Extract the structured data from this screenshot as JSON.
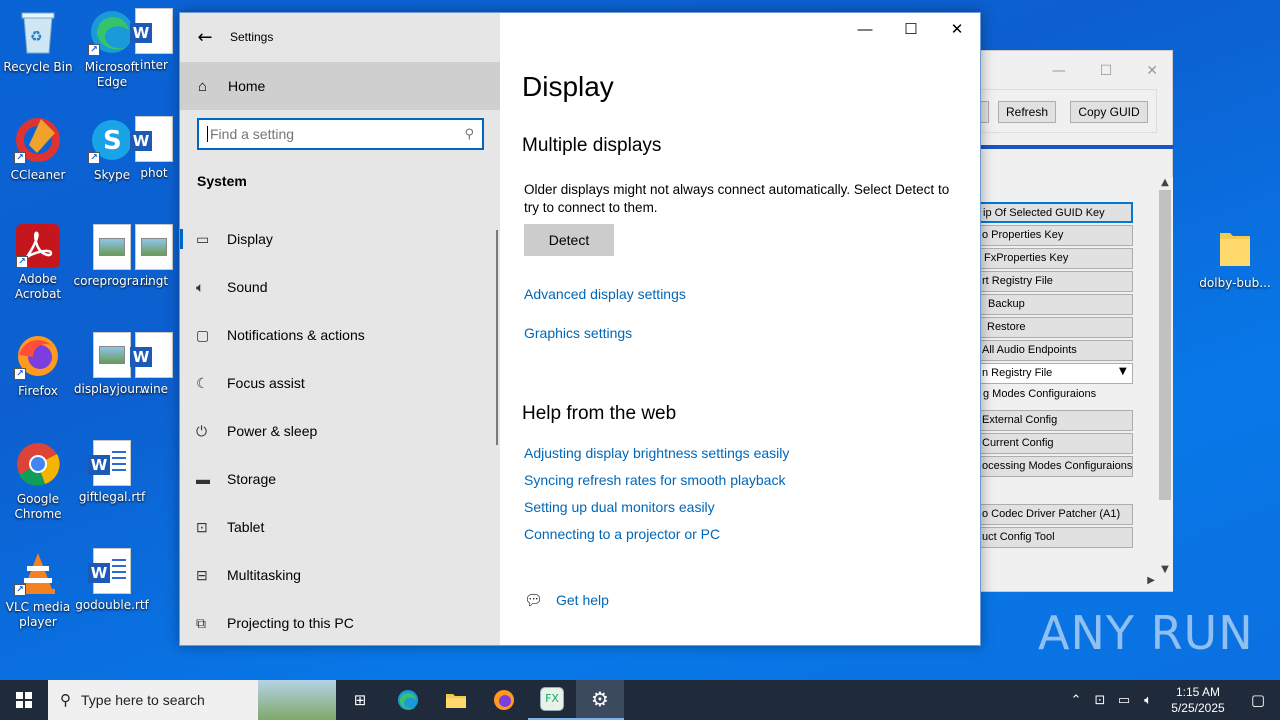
{
  "desktop": {
    "icons": [
      {
        "label": "Recycle Bin"
      },
      {
        "label": "Microsoft Edge"
      },
      {
        "label": "inter"
      },
      {
        "label": "CCleaner"
      },
      {
        "label": "Skype"
      },
      {
        "label": "phot"
      },
      {
        "label": "Adobe Acrobat"
      },
      {
        "label": "coreprogra..."
      },
      {
        "label": "ringt"
      },
      {
        "label": "Firefox"
      },
      {
        "label": "displayjour..."
      },
      {
        "label": "wine"
      },
      {
        "label": "Google Chrome"
      },
      {
        "label": "giftlegal.rtf"
      },
      {
        "label": "VLC media player"
      },
      {
        "label": "godouble.rtf"
      },
      {
        "label": "dolby-bub..."
      }
    ]
  },
  "background_app": {
    "refresh_label": "Refresh",
    "copy_guid_label": "Copy GUID",
    "items": [
      "ip Of Selected GUID Key",
      "o Properties Key",
      "FxProperties Key",
      "rt Registry File",
      "Backup",
      "Restore",
      "All Audio Endpoints",
      "n Registry File",
      "g Modes Configuraions",
      "External Config",
      "Current Config",
      "ocessing Modes Configuraions",
      "o Codec Driver Patcher (A1)",
      "uct Config Tool"
    ]
  },
  "settings": {
    "window_title": "Settings",
    "home_label": "Home",
    "search_placeholder": "Find a setting",
    "section_label": "System",
    "nav": [
      {
        "label": "Display",
        "icon": "monitor-icon"
      },
      {
        "label": "Sound",
        "icon": "speaker-icon"
      },
      {
        "label": "Notifications & actions",
        "icon": "message-icon"
      },
      {
        "label": "Focus assist",
        "icon": "moon-icon"
      },
      {
        "label": "Power & sleep",
        "icon": "power-icon"
      },
      {
        "label": "Storage",
        "icon": "drive-icon"
      },
      {
        "label": "Tablet",
        "icon": "tablet-icon"
      },
      {
        "label": "Multitasking",
        "icon": "multitasking-icon"
      },
      {
        "label": "Projecting to this PC",
        "icon": "projector-icon"
      }
    ],
    "page_title": "Display",
    "multiple_displays_heading": "Multiple displays",
    "multiple_displays_text": "Older displays might not always connect automatically. Select Detect to try to connect to them.",
    "detect_label": "Detect",
    "advanced_link": "Advanced display settings",
    "graphics_link": "Graphics settings",
    "help_heading": "Help from the web",
    "help_links": [
      "Adjusting display brightness settings easily",
      "Syncing refresh rates for smooth playback",
      "Setting up dual monitors easily",
      "Connecting to a projector or PC"
    ],
    "get_help_label": "Get help"
  },
  "watermark": "ANY  RUN",
  "taskbar": {
    "search_placeholder": "Type here to search",
    "time": "1:15 AM",
    "date": "5/25/2025"
  }
}
